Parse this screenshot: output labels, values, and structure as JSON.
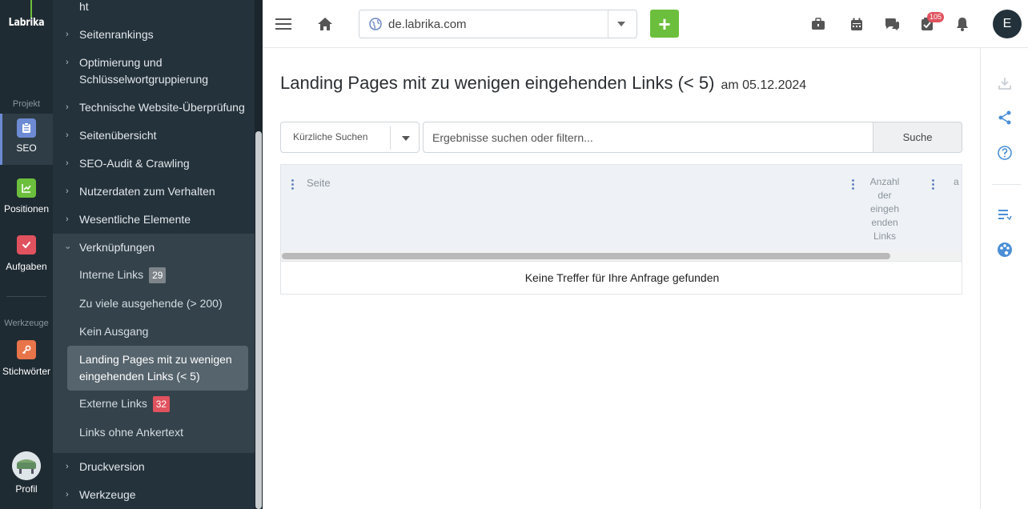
{
  "rail": {
    "brand": "Labrika",
    "section_project": "Projekt",
    "section_tools": "Werkzeuge",
    "items": [
      {
        "label": "SEO",
        "icon": "clipboard-icon",
        "color": "#6d8bd4"
      },
      {
        "label": "Positionen",
        "icon": "chart-icon",
        "color": "#6cbf3c"
      },
      {
        "label": "Aufgaben",
        "icon": "check-icon",
        "color": "#e0525e"
      },
      {
        "label": "Stichwörter",
        "icon": "key-icon",
        "color": "#e8744a"
      }
    ],
    "profile": "Profil"
  },
  "sidebar": {
    "top_partial": "ht",
    "items": [
      {
        "label": "Seitenrankings"
      },
      {
        "label": "Optimierung und Schlüsselwortgruppierung"
      },
      {
        "label": "Technische Website-Überprüfung"
      },
      {
        "label": "Seitenübersicht"
      },
      {
        "label": "SEO-Audit & Crawling"
      },
      {
        "label": "Nutzerdaten zum Verhalten"
      },
      {
        "label": "Wesentliche Elemente"
      }
    ],
    "open_group": "Verknüpfungen",
    "sub_items": [
      {
        "label": "Interne Links",
        "badge": "29"
      },
      {
        "label": "Zu viele ausgehende (> 200)"
      },
      {
        "label": "Kein Ausgang"
      },
      {
        "label": "Landing Pages mit zu wenigen eingehenden Links (< 5)"
      },
      {
        "label": "Externe Links",
        "badge": "32"
      },
      {
        "label": "Links ohne Ankertext"
      }
    ],
    "bottom_items": [
      {
        "label": "Druckversion"
      },
      {
        "label": "Werkzeuge"
      }
    ]
  },
  "topbar": {
    "domain": "de.labrika.com",
    "add_label": "+",
    "notification_count": "105",
    "avatar_initial": "E"
  },
  "main": {
    "title": "Landing Pages mit zu wenigen eingehenden Links (< 5)",
    "date": "am 05.12.2024",
    "recent_searches": "Kürzliche Suchen",
    "search_placeholder": "Ergebnisse suchen oder filtern...",
    "search_button": "Suche",
    "table": {
      "col_page": "Seite",
      "col_count": "Anzahl der eingeh enden Links",
      "col_cut": "a",
      "empty_message": "Keine Treffer für Ihre Anfrage gefunden"
    }
  },
  "colors": {
    "accent_green": "#6cbf3c",
    "badge_red": "#e0525e",
    "link_blue": "#4a8fd6"
  }
}
